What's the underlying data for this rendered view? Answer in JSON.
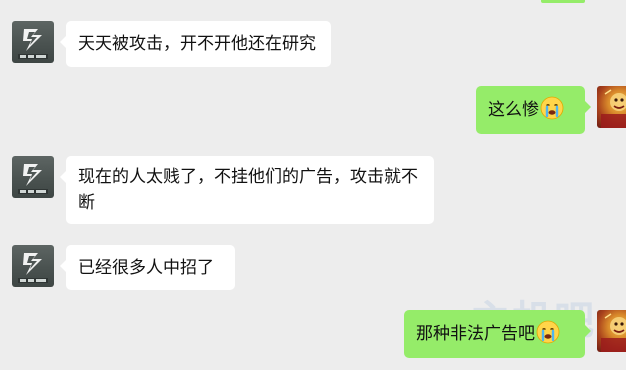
{
  "colors": {
    "background": "#ededed",
    "incoming_bubble": "#ffffff",
    "outgoing_bubble": "#95ec69"
  },
  "messages": [
    {
      "side": "incoming",
      "text": "天天被攻击，开不开他还在研究",
      "emoji": ""
    },
    {
      "side": "outgoing",
      "text": "这么惨",
      "emoji": "crying-face"
    },
    {
      "side": "incoming",
      "text": "现在的人太贱了，不挂他们的广告，攻击就不断",
      "emoji": ""
    },
    {
      "side": "incoming",
      "text": "已经很多人中招了",
      "emoji": ""
    },
    {
      "side": "outgoing",
      "text": "那种非法广告吧",
      "emoji": "crying-face"
    }
  ],
  "watermark": "主机吧"
}
